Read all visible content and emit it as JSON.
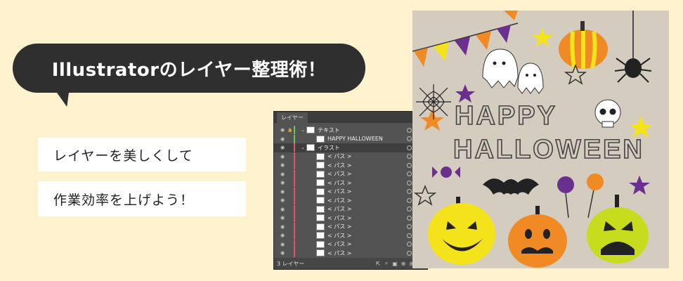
{
  "headline": "Illustratorのレイヤー整理術！",
  "cards": [
    "レイヤーを美しくして",
    "作業効率を上げよう！"
  ],
  "panel": {
    "tab": "レイヤー",
    "footer_label": "3 レイヤー",
    "rows": [
      {
        "label": "テキスト",
        "kind": "layer",
        "color": "#5fc95f"
      },
      {
        "label": "HAPPY HALLOWEEN",
        "kind": "sub",
        "color": "#5fc95f"
      },
      {
        "label": "イラスト",
        "kind": "layer",
        "color": "#e0556b",
        "selected": true
      },
      {
        "label": "< パス >",
        "kind": "path",
        "color": "#e0556b"
      },
      {
        "label": "< パス >",
        "kind": "path",
        "color": "#e0556b"
      },
      {
        "label": "< パス >",
        "kind": "path",
        "color": "#e0556b"
      },
      {
        "label": "< パス >",
        "kind": "path",
        "color": "#e0556b"
      },
      {
        "label": "< パス >",
        "kind": "path",
        "color": "#e0556b"
      },
      {
        "label": "< パス >",
        "kind": "path",
        "color": "#e0556b"
      },
      {
        "label": "< パス >",
        "kind": "path",
        "color": "#e0556b"
      },
      {
        "label": "< パス >",
        "kind": "path",
        "color": "#e0556b"
      },
      {
        "label": "< パス >",
        "kind": "path",
        "color": "#e0556b"
      },
      {
        "label": "< パス >",
        "kind": "path",
        "color": "#e0556b"
      },
      {
        "label": "< パス >",
        "kind": "path",
        "color": "#e0556b"
      },
      {
        "label": "< パス >",
        "kind": "path",
        "color": "#e0556b"
      }
    ]
  },
  "illustration": {
    "line1": "HAPPY",
    "line2": "HALLOWEEN",
    "colors": {
      "bg": "#d4ccbf",
      "orange": "#f08a24",
      "yellow": "#f4e31a",
      "purple": "#6b2f8f",
      "lime": "#c8dc1e"
    }
  }
}
